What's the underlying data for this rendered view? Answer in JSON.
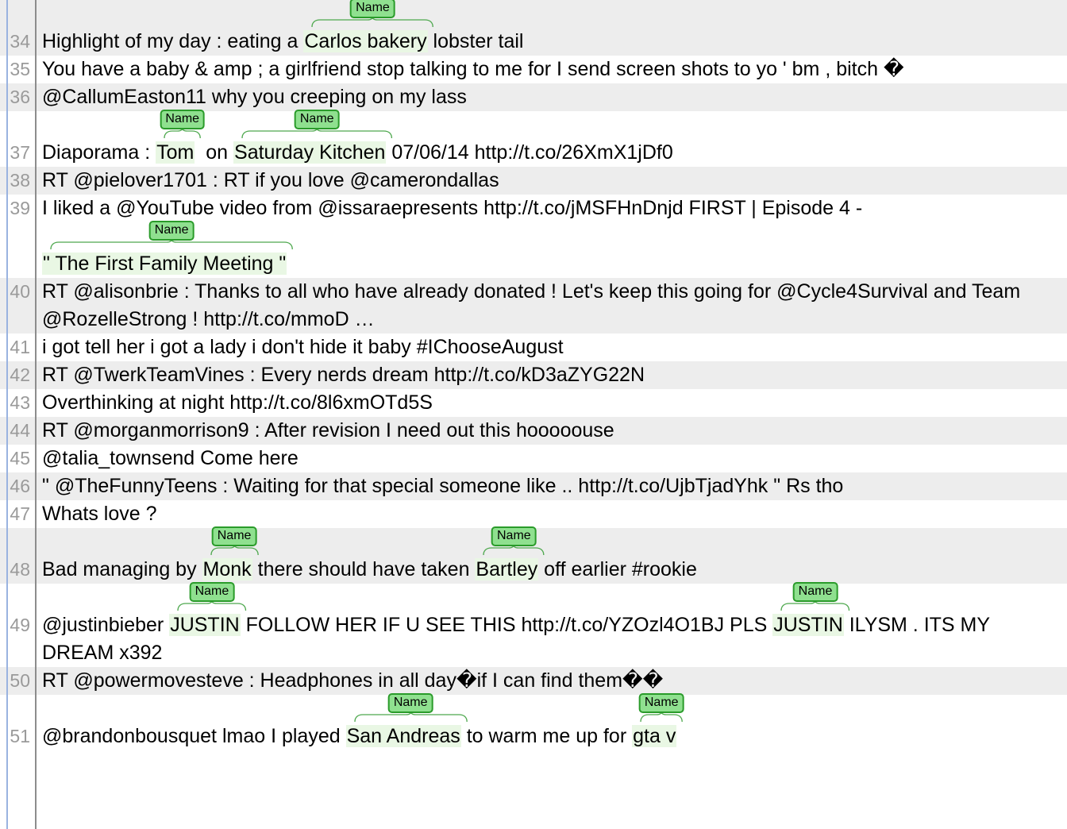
{
  "view": {
    "title": "Text annotation view",
    "entity_label": "Name",
    "colors": {
      "tag_fill": "#8fe08f",
      "tag_border": "#2a9b2a",
      "entity_highlight": "#e9f7e4",
      "row_alt": "#ededed",
      "row_base": "#ffffff",
      "gutter_text": "#9a9a9a",
      "text": "#000000",
      "left_rail": "#9ab3e0",
      "gutter_rule": "#8d8d8d"
    }
  },
  "rows": [
    {
      "number": "34",
      "alt": true,
      "lines": [
        {
          "has_annotations": true,
          "segments": [
            {
              "text": "Highlight of my day : eating a ",
              "entity": false
            },
            {
              "text": "Carlos bakery",
              "entity": true,
              "label": "Name"
            },
            {
              "text": " lobster tail",
              "entity": false
            }
          ]
        }
      ]
    },
    {
      "number": "35",
      "alt": false,
      "lines": [
        {
          "has_annotations": false,
          "segments": [
            {
              "text": "You have a baby & amp ; a girlfriend stop talking to me for I send screen shots to yo ' bm , bitch �",
              "entity": false
            }
          ]
        }
      ]
    },
    {
      "number": "36",
      "alt": true,
      "lines": [
        {
          "has_annotations": false,
          "segments": [
            {
              "text": "@CallumEaston11 why you creeping on my lass",
              "entity": false
            }
          ]
        }
      ]
    },
    {
      "number": "37",
      "alt": false,
      "lines": [
        {
          "has_annotations": true,
          "segments": [
            {
              "text": "Diaporama : ",
              "entity": false
            },
            {
              "text": "Tom",
              "entity": true,
              "label": "Name"
            },
            {
              "text": "  on ",
              "entity": false
            },
            {
              "text": "Saturday Kitchen",
              "entity": true,
              "label": "Name"
            },
            {
              "text": " 07/06/14 http://t.co/26XmX1jDf0",
              "entity": false
            }
          ]
        }
      ]
    },
    {
      "number": "38",
      "alt": true,
      "lines": [
        {
          "has_annotations": false,
          "segments": [
            {
              "text": "RT @pielover1701 : RT if you love @camerondallas",
              "entity": false
            }
          ]
        }
      ]
    },
    {
      "number": "39",
      "alt": false,
      "lines": [
        {
          "has_annotations": false,
          "segments": [
            {
              "text": "I liked a @YouTube video from @issaraepresents http://t.co/jMSFHnDnjd FIRST | Episode 4 -",
              "entity": false
            }
          ]
        },
        {
          "has_annotations": true,
          "segments": [
            {
              "text": "\" The First Family Meeting \"",
              "entity": true,
              "label": "Name"
            }
          ]
        }
      ]
    },
    {
      "number": "40",
      "alt": true,
      "lines": [
        {
          "has_annotations": false,
          "segments": [
            {
              "text": "RT @alisonbrie : Thanks to all who have already donated ! Let's keep this going for @Cycle4Survival and Team",
              "entity": false
            }
          ]
        },
        {
          "has_annotations": false,
          "segments": [
            {
              "text": "@RozelleStrong ! http://t.co/mmoD …",
              "entity": false
            }
          ]
        }
      ]
    },
    {
      "number": "41",
      "alt": false,
      "lines": [
        {
          "has_annotations": false,
          "segments": [
            {
              "text": "i got tell her i got a lady i don't hide it baby #IChooseAugust",
              "entity": false
            }
          ]
        }
      ]
    },
    {
      "number": "42",
      "alt": true,
      "lines": [
        {
          "has_annotations": false,
          "segments": [
            {
              "text": "RT @TwerkTeamVines : Every nerds dream http://t.co/kD3aZYG22N",
              "entity": false
            }
          ]
        }
      ]
    },
    {
      "number": "43",
      "alt": false,
      "lines": [
        {
          "has_annotations": false,
          "segments": [
            {
              "text": "Overthinking at night http://t.co/8l6xmOTd5S",
              "entity": false
            }
          ]
        }
      ]
    },
    {
      "number": "44",
      "alt": true,
      "lines": [
        {
          "has_annotations": false,
          "segments": [
            {
              "text": "RT @morganmorrison9 : After revision I need out this hooooouse",
              "entity": false
            }
          ]
        }
      ]
    },
    {
      "number": "45",
      "alt": false,
      "lines": [
        {
          "has_annotations": false,
          "segments": [
            {
              "text": "@talia_townsend Come here",
              "entity": false
            }
          ]
        }
      ]
    },
    {
      "number": "46",
      "alt": true,
      "lines": [
        {
          "has_annotations": false,
          "segments": [
            {
              "text": "\" @TheFunnyTeens : Waiting for that special someone like .. http://t.co/UjbTjadYhk \" Rs tho",
              "entity": false
            }
          ]
        }
      ]
    },
    {
      "number": "47",
      "alt": false,
      "lines": [
        {
          "has_annotations": false,
          "segments": [
            {
              "text": "Whats love ?",
              "entity": false
            }
          ]
        }
      ]
    },
    {
      "number": "48",
      "alt": true,
      "lines": [
        {
          "has_annotations": true,
          "segments": [
            {
              "text": "Bad managing by ",
              "entity": false
            },
            {
              "text": "Monk",
              "entity": true,
              "label": "Name"
            },
            {
              "text": " there should have taken ",
              "entity": false
            },
            {
              "text": "Bartley",
              "entity": true,
              "label": "Name"
            },
            {
              "text": " off earlier #rookie",
              "entity": false
            }
          ]
        }
      ]
    },
    {
      "number": "49",
      "alt": false,
      "lines": [
        {
          "has_annotations": true,
          "segments": [
            {
              "text": "@justinbieber ",
              "entity": false
            },
            {
              "text": "JUSTIN",
              "entity": true,
              "label": "Name"
            },
            {
              "text": " FOLLOW HER IF U SEE THIS http://t.co/YZOzl4O1BJ PLS ",
              "entity": false
            },
            {
              "text": "JUSTIN",
              "entity": true,
              "label": "Name"
            },
            {
              "text": " ILYSM . ITS MY",
              "entity": false
            }
          ]
        },
        {
          "has_annotations": false,
          "segments": [
            {
              "text": "DREAM x392",
              "entity": false
            }
          ]
        }
      ]
    },
    {
      "number": "50",
      "alt": true,
      "lines": [
        {
          "has_annotations": false,
          "segments": [
            {
              "text": "RT @powermovesteve : Headphones in all day�if I can find them��",
              "entity": false
            }
          ]
        }
      ]
    },
    {
      "number": "51",
      "alt": false,
      "lines": [
        {
          "has_annotations": true,
          "segments": [
            {
              "text": "@brandonbousquet lmao I played ",
              "entity": false
            },
            {
              "text": "San Andreas",
              "entity": true,
              "label": "Name"
            },
            {
              "text": " to warm me up for ",
              "entity": false
            },
            {
              "text": "gta v",
              "entity": true,
              "label": "Name"
            }
          ]
        }
      ]
    }
  ]
}
